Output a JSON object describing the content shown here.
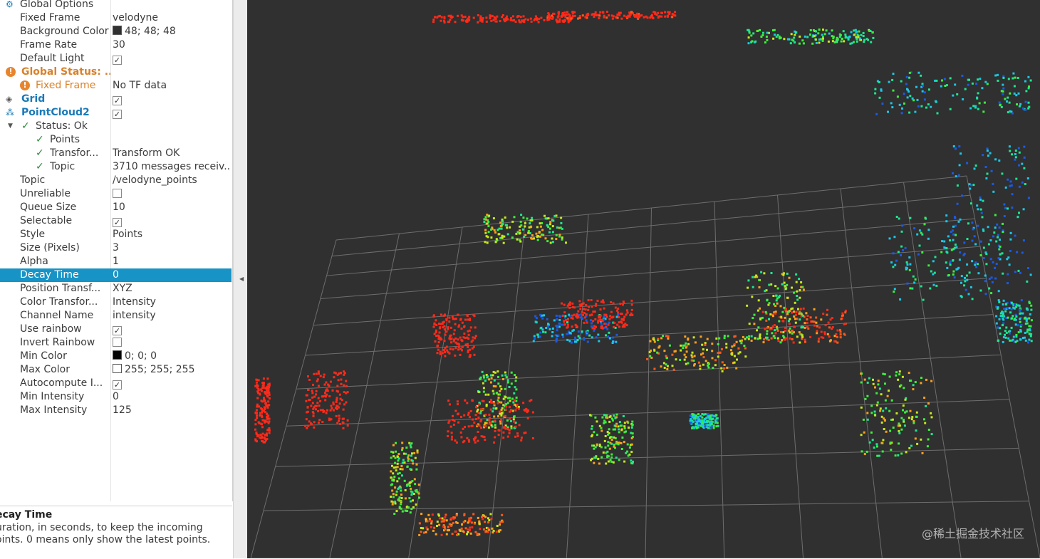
{
  "properties": [
    {
      "label": "Global Options",
      "value": "",
      "indent": 28,
      "kind": "partial"
    },
    {
      "label": "Fixed Frame",
      "value": "velodyne",
      "indent": 28
    },
    {
      "label": "Background Color",
      "value": "48; 48; 48",
      "indent": 28,
      "swatch": "#303030"
    },
    {
      "label": "Frame Rate",
      "value": "30",
      "indent": 28
    },
    {
      "label": "Default Light",
      "value": "",
      "indent": 28,
      "checkbox": true
    },
    {
      "label": "Global Status: ...",
      "value": "",
      "indent": 30,
      "kind": "warn-top"
    },
    {
      "label": "Fixed Frame",
      "value": "No TF data",
      "indent": 50,
      "kind": "warn-sub"
    },
    {
      "label": "Grid",
      "value": "",
      "indent": 30,
      "kind": "display",
      "icon": "grid-icon",
      "checkbox": true
    },
    {
      "label": "PointCloud2",
      "value": "",
      "indent": 30,
      "kind": "display",
      "icon": "pointcloud-icon",
      "checkbox": true
    },
    {
      "label": "Status: Ok",
      "value": "",
      "indent": 50,
      "kind": "ok-top"
    },
    {
      "label": "Points",
      "value": "",
      "indent": 70,
      "kind": "ok-sub"
    },
    {
      "label": "Transfor...",
      "value": "Transform OK",
      "indent": 70,
      "kind": "ok-sub"
    },
    {
      "label": "Topic",
      "value": "3710 messages receiv...",
      "indent": 70,
      "kind": "ok-sub"
    },
    {
      "label": "Topic",
      "value": "/velodyne_points",
      "indent": 28
    },
    {
      "label": "Unreliable",
      "value": "",
      "indent": 28,
      "checkbox": false
    },
    {
      "label": "Queue Size",
      "value": "10",
      "indent": 28
    },
    {
      "label": "Selectable",
      "value": "",
      "indent": 28,
      "checkbox": true
    },
    {
      "label": "Style",
      "value": "Points",
      "indent": 28
    },
    {
      "label": "Size (Pixels)",
      "value": "3",
      "indent": 28
    },
    {
      "label": "Alpha",
      "value": "1",
      "indent": 28
    },
    {
      "label": "Decay Time",
      "value": "0",
      "indent": 28,
      "selected": true
    },
    {
      "label": "Position Transf...",
      "value": "XYZ",
      "indent": 28
    },
    {
      "label": "Color Transfor...",
      "value": "Intensity",
      "indent": 28
    },
    {
      "label": "Channel Name",
      "value": "intensity",
      "indent": 28
    },
    {
      "label": "Use rainbow",
      "value": "",
      "indent": 28,
      "checkbox": true
    },
    {
      "label": "Invert Rainbow",
      "value": "",
      "indent": 28,
      "checkbox": false
    },
    {
      "label": "Min Color",
      "value": "0; 0; 0",
      "indent": 28,
      "swatch": "#000000"
    },
    {
      "label": "Max Color",
      "value": "255; 255; 255",
      "indent": 28,
      "swatch": "#ffffff"
    },
    {
      "label": "Autocompute I...",
      "value": "",
      "indent": 28,
      "checkbox": true
    },
    {
      "label": "Min Intensity",
      "value": "0",
      "indent": 28
    },
    {
      "label": "Max Intensity",
      "value": "125",
      "indent": 28
    }
  ],
  "description": {
    "title": "ecay Time",
    "text": "uration, in seconds, to keep the incoming oints. 0 means only show the latest points."
  },
  "viewport": {
    "background": "#303030",
    "grid_color": "#a0a0a0",
    "watermark": "@稀土掘金技术社区"
  },
  "colors": {
    "selection": "#1793c6",
    "display_name": "#1a7ab8",
    "warning": "#d9822b",
    "ok": "#2c8a3a"
  }
}
